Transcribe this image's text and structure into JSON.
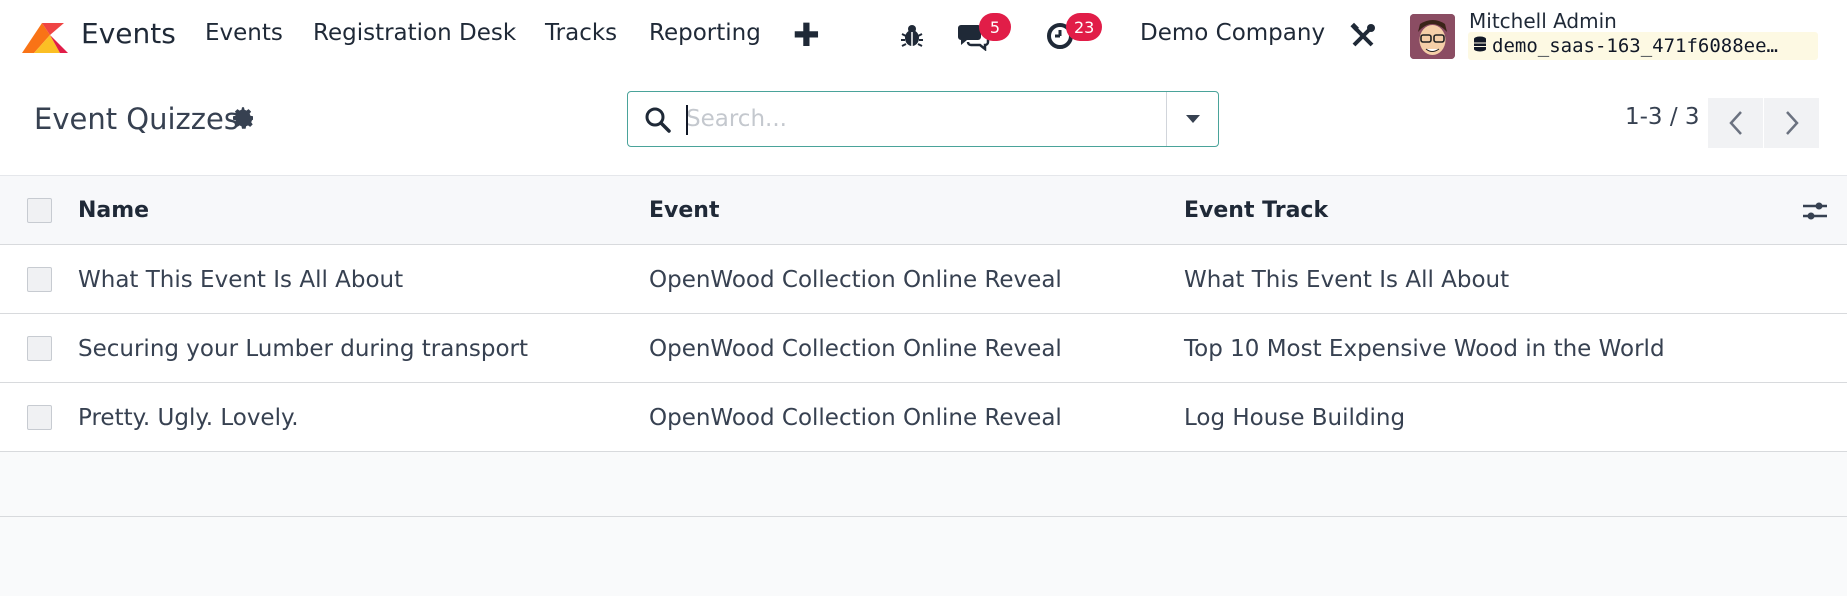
{
  "navbar": {
    "app_name": "Events",
    "menu": [
      "Events",
      "Registration Desk",
      "Tracks",
      "Reporting"
    ],
    "messages_count": "5",
    "activities_count": "23",
    "company": "Demo Company",
    "user_name": "Mitchell Admin",
    "database": "demo_saas-163_471f6088ee…"
  },
  "control": {
    "title": "Event Quizzes",
    "search_placeholder": "Search...",
    "pager_value": "1-3 / 3"
  },
  "table": {
    "columns": [
      "Name",
      "Event",
      "Event Track"
    ],
    "rows": [
      {
        "name": "What This Event Is All About",
        "event": "OpenWood Collection Online Reveal",
        "track": "What This Event Is All About"
      },
      {
        "name": "Securing your Lumber during transport",
        "event": "OpenWood Collection Online Reveal",
        "track": "Top 10 Most Expensive Wood in the World"
      },
      {
        "name": "Pretty. Ugly. Lovely.",
        "event": "OpenWood Collection Online Reveal",
        "track": "Log House Building"
      }
    ]
  },
  "colors": {
    "accent": "#4aa39a",
    "badge": "#e11d48",
    "brand_logo": "#f97316"
  },
  "icons": [
    "app-logo-icon",
    "plus-icon",
    "bug-icon",
    "chat-icon",
    "clock-icon",
    "tools-icon",
    "database-icon",
    "gear-icon",
    "search-icon",
    "caret-down-icon",
    "chevron-left-icon",
    "chevron-right-icon",
    "optional-columns-icon"
  ]
}
